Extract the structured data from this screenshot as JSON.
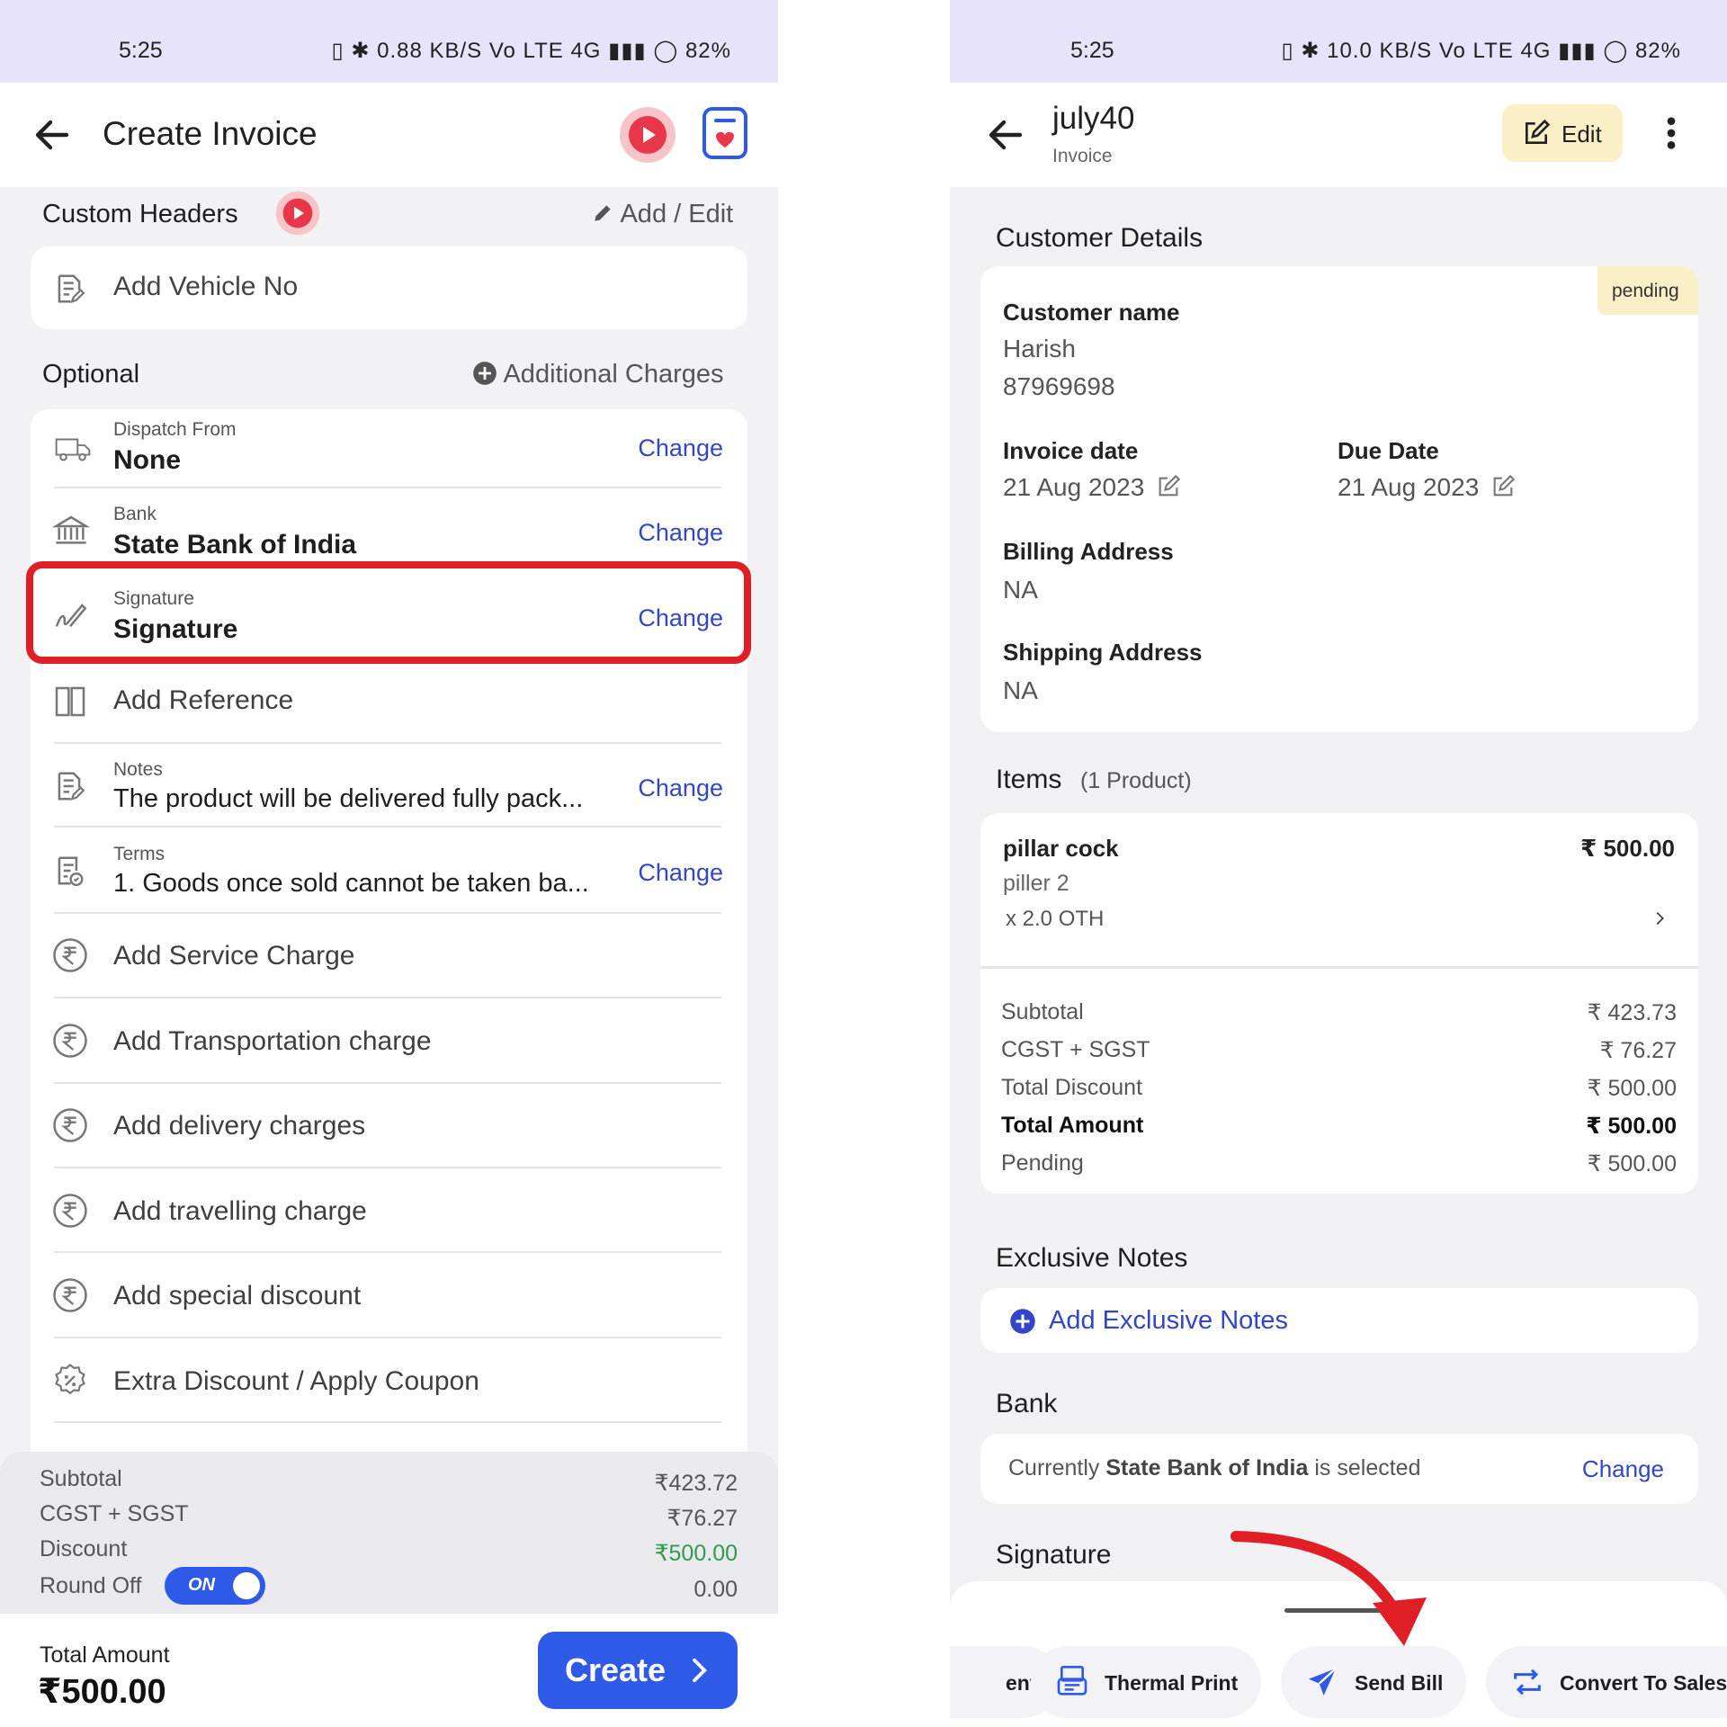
{
  "status_bar": {
    "time": "5:25",
    "left_icons": "▯ ✱ 0.88 KB/S Vo LTE 4G ▮▮▮ ◯ 82%",
    "right_icons": "▯ ✱ 10.0 KB/S Vo LTE 4G ▮▮▮ ◯ 82%"
  },
  "left": {
    "title": "Create Invoice",
    "custom_headers": {
      "label": "Custom Headers",
      "add_edit": "Add / Edit",
      "vehicle_placeholder": "Add Vehicle No"
    },
    "optional": {
      "label": "Optional",
      "additional_charges": "Additional Charges"
    },
    "dispatch": {
      "label": "Dispatch From",
      "value": "None",
      "action": "Change"
    },
    "bank": {
      "label": "Bank",
      "value": "State Bank of India",
      "action": "Change"
    },
    "signature": {
      "label": "Signature",
      "value": "Signature",
      "action": "Change"
    },
    "reference": "Add Reference",
    "notes": {
      "label": "Notes",
      "value": "The product will be delivered fully pack...",
      "action": "Change"
    },
    "terms": {
      "label": "Terms",
      "value": "1. Goods once sold cannot be taken ba...",
      "action": "Change"
    },
    "charges": [
      "Add Service Charge",
      "Add Transportation charge",
      "Add delivery charges",
      "Add travelling charge",
      "Add special discount"
    ],
    "coupon": "Extra Discount / Apply Coupon",
    "summary": {
      "subtotal_label": "Subtotal",
      "subtotal": "₹423.72",
      "tax_label": "CGST + SGST",
      "tax": "₹76.27",
      "discount_label": "Discount",
      "discount": "₹500.00",
      "roundoff_label": "Round Off",
      "roundoff_toggle": "ON",
      "roundoff": "0.00"
    },
    "footer": {
      "total_label": "Total Amount",
      "total": "₹500.00",
      "create": "Create"
    }
  },
  "right": {
    "title": "july40",
    "subtitle": "Invoice",
    "edit": "Edit",
    "customer_section": "Customer Details",
    "status_badge": "pending",
    "customer_name_label": "Customer name",
    "customer_name": "Harish",
    "customer_phone": "87969698",
    "invoice_date_label": "Invoice date",
    "invoice_date": "21 Aug 2023",
    "due_date_label": "Due Date",
    "due_date": "21 Aug 2023",
    "billing_label": "Billing Address",
    "billing": "NA",
    "shipping_label": "Shipping Address",
    "shipping": "NA",
    "items_label": "Items",
    "items_count": "(1 Product)",
    "item": {
      "name": "pillar cock",
      "price": "₹ 500.00",
      "desc": "piller 2",
      "qty": "x 2.0 OTH"
    },
    "summary": {
      "subtotal_label": "Subtotal",
      "subtotal": "₹ 423.73",
      "tax_label": "CGST + SGST",
      "tax": "₹ 76.27",
      "discount_label": "Total Discount",
      "discount": "₹ 500.00",
      "total_label": "Total Amount",
      "total": "₹ 500.00",
      "pending_label": "Pending",
      "pending": "₹ 500.00"
    },
    "notes_section": "Exclusive Notes",
    "add_notes": "Add Exclusive Notes",
    "bank_section": "Bank",
    "bank_prefix": "Currently",
    "bank_name": "State Bank of India",
    "bank_suffix": "is selected",
    "bank_change": "Change",
    "signature_section": "Signature",
    "actions": {
      "partial": "ent",
      "thermal": "Thermal Print",
      "send": "Send Bill",
      "convert": "Convert To Sales"
    }
  },
  "colors": {
    "accent": "#2f5ae8",
    "annotation_red": "#e01e25",
    "pending_bg": "#fbefc7",
    "edit_bg": "#fbefc7",
    "link": "#3246c7",
    "discount_green": "#2e9b4e"
  }
}
